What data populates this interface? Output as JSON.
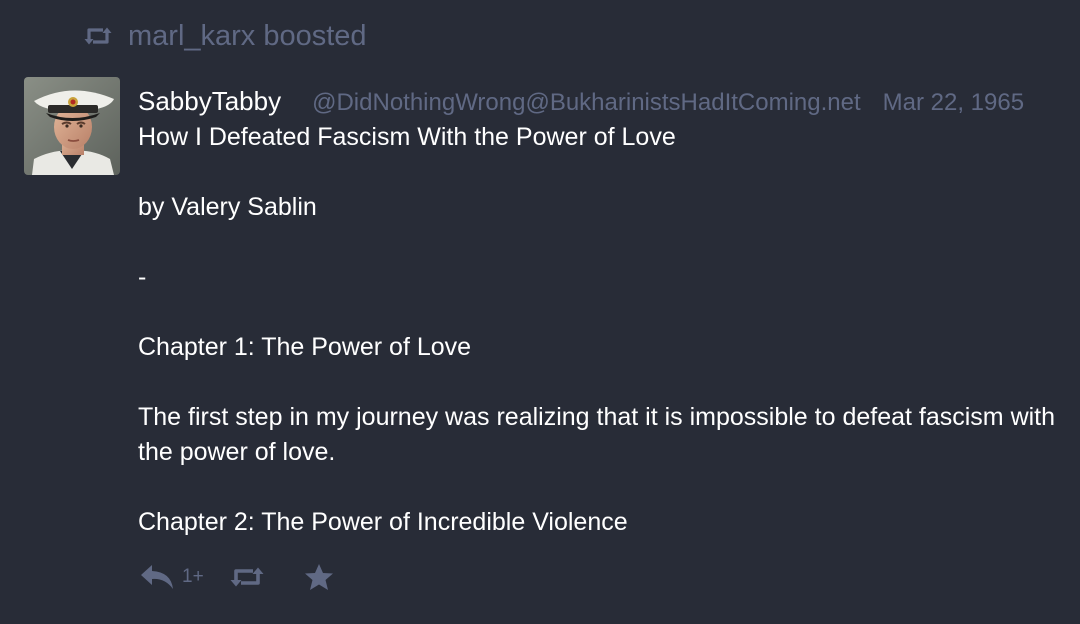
{
  "boost_notice": {
    "icon": "retweet-icon",
    "text": "marl_karx boosted"
  },
  "status": {
    "avatar_icon": "avatar",
    "display_name": "SabbyTabby",
    "acct": "@DidNothingWrong@BukharinistsHadItComing.net",
    "date": "Mar 22, 1965",
    "paragraphs": [
      "How I Defeated Fascism With the Power of Love",
      "by Valery Sablin",
      "-",
      "Chapter 1: The Power of Love",
      "The first step in my journey was realizing that it is impossible to defeat fascism with the power of love.",
      "Chapter 2: The Power of Incredible Violence"
    ]
  },
  "actions": {
    "reply_icon": "reply-icon",
    "reply_count": "1+",
    "boost_icon": "retweet-icon",
    "favourite_icon": "star-icon"
  },
  "colors": {
    "background": "#282c37",
    "muted": "#606984",
    "text": "#ffffff"
  }
}
